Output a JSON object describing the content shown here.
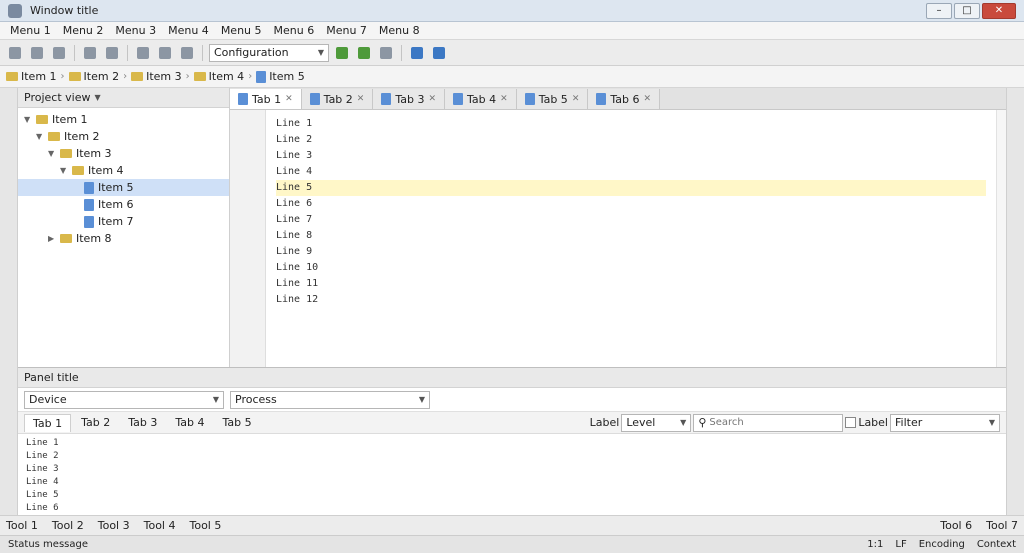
{
  "window": {
    "title": "Window title"
  },
  "menu": {
    "items": [
      "Menu 1",
      "Menu 2",
      "Menu 3",
      "Menu 4",
      "Menu 5",
      "Menu 6",
      "Menu 7",
      "Menu 8"
    ]
  },
  "toolbar": {
    "run_config": "Configuration"
  },
  "breadcrumbs": [
    "Item 1",
    "Item 2",
    "Item 3",
    "Item 4",
    "Item 5"
  ],
  "project": {
    "view": "Project view",
    "tree": [
      {
        "label": "Item 1",
        "kind": "folder"
      },
      {
        "label": "Item 2",
        "kind": "folder"
      },
      {
        "label": "Item 3",
        "kind": "folder"
      },
      {
        "label": "Item 4",
        "kind": "folder"
      },
      {
        "label": "Item 5",
        "kind": "file"
      },
      {
        "label": "Item 6",
        "kind": "file"
      },
      {
        "label": "Item 7",
        "kind": "file"
      },
      {
        "label": "Item 8",
        "kind": "folder"
      }
    ]
  },
  "editor": {
    "tabs": [
      "Tab 1",
      "Tab 2",
      "Tab 3",
      "Tab 4",
      "Tab 5",
      "Tab 6"
    ],
    "lines": [
      "Line 1",
      "Line 2",
      "Line 3",
      "Line 4",
      "Line 5",
      "Line 6",
      "Line 7",
      "Line 8",
      "Line 9",
      "Line 10",
      "Line 11",
      "Line 12"
    ]
  },
  "monitor": {
    "title": "Panel title",
    "device": "Device",
    "process": "Process",
    "tabs": [
      "Tab 1",
      "Tab 2",
      "Tab 3",
      "Tab 4",
      "Tab 5"
    ],
    "log_level_label": "Label",
    "log_level": "Level",
    "search_placeholder": "Search",
    "regex_label": "Label",
    "filter": "Filter",
    "lines": [
      "Line 1",
      "Line 2",
      "Line 3",
      "Line 4",
      "Line 5",
      "Line 6"
    ]
  },
  "bottom_tools": [
    "Tool 1",
    "Tool 2",
    "Tool 3",
    "Tool 4",
    "Tool 5",
    "Tool 6",
    "Tool 7"
  ],
  "status": {
    "message": "Status message",
    "position": "1:1",
    "line_sep": "LF",
    "encoding": "Encoding",
    "context": "Context"
  }
}
